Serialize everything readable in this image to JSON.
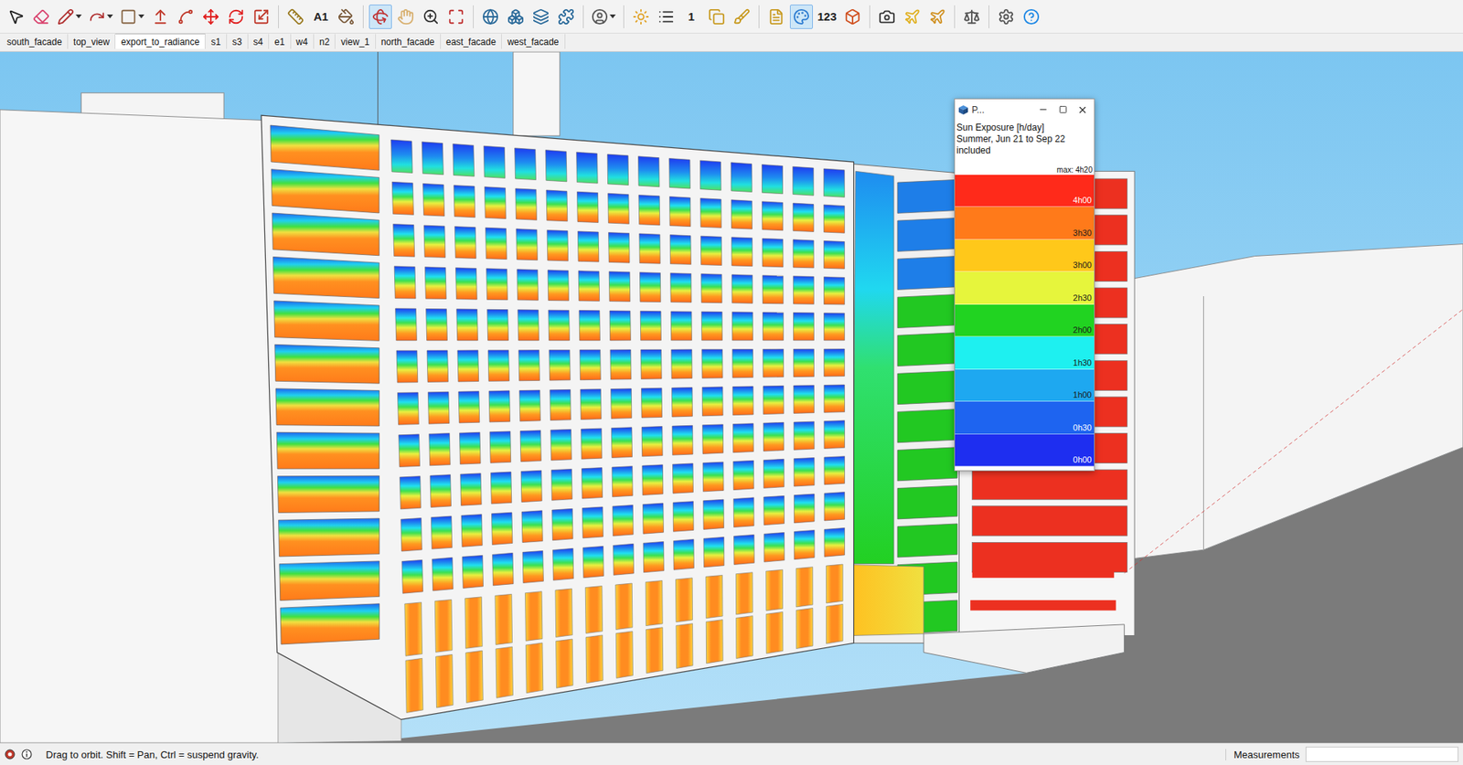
{
  "toolbar": {
    "items": [
      {
        "text": "",
        "selected": false
      },
      {
        "text": "",
        "selected": false
      },
      {
        "text": "",
        "selected": false
      },
      {
        "text": "",
        "selected": false
      },
      {
        "text": "",
        "selected": false
      },
      {
        "text": "",
        "selected": false
      },
      {
        "text": "",
        "selected": false
      },
      {
        "text": "",
        "selected": false
      },
      {
        "text": "",
        "selected": false
      },
      {
        "text": "",
        "selected": false
      },
      {
        "text": "",
        "selected": false
      },
      {
        "text": "A1",
        "selected": false
      },
      {
        "text": "",
        "selected": false
      },
      {
        "text": "",
        "selected": true
      },
      {
        "text": "",
        "selected": false
      },
      {
        "text": "",
        "selected": false
      },
      {
        "text": "",
        "selected": false
      },
      {
        "text": "",
        "selected": false
      },
      {
        "text": "",
        "selected": false
      },
      {
        "text": "",
        "selected": false
      },
      {
        "text": "",
        "selected": false
      },
      {
        "text": "",
        "selected": false
      },
      {
        "text": "",
        "selected": false
      },
      {
        "text": "",
        "selected": false
      },
      {
        "text": "1",
        "selected": false
      },
      {
        "text": "",
        "selected": false
      },
      {
        "text": "",
        "selected": false
      },
      {
        "text": "",
        "selected": false
      },
      {
        "text": "",
        "selected": true
      },
      {
        "text": "123",
        "selected": false
      },
      {
        "text": "",
        "selected": false
      },
      {
        "text": "",
        "selected": false
      },
      {
        "text": "",
        "selected": false
      },
      {
        "text": "",
        "selected": false
      },
      {
        "text": "",
        "selected": false
      },
      {
        "text": "",
        "selected": false
      },
      {
        "text": "",
        "selected": false
      }
    ]
  },
  "tabs": [
    {
      "label": "south_facade",
      "selected": false
    },
    {
      "label": "top_view",
      "selected": false
    },
    {
      "label": "export_to_radiance",
      "selected": true
    },
    {
      "label": "s1",
      "selected": false
    },
    {
      "label": "s3",
      "selected": false
    },
    {
      "label": "s4",
      "selected": false
    },
    {
      "label": "e1",
      "selected": false
    },
    {
      "label": "w4",
      "selected": false
    },
    {
      "label": "n2",
      "selected": false
    },
    {
      "label": "view_1",
      "selected": false
    },
    {
      "label": "north_facade",
      "selected": false
    },
    {
      "label": "east_facade",
      "selected": false
    },
    {
      "label": "west_facade",
      "selected": false
    }
  ],
  "legend": {
    "title": "P...",
    "lines": [
      "Sun Exposure [h/day]",
      "Summer, Jun 21 to Sep 22",
      "included"
    ],
    "max": "max: 4h20",
    "bands": [
      {
        "label": "4h00",
        "color": "#ff2a1a"
      },
      {
        "label": "3h30",
        "color": "#ff7a1a"
      },
      {
        "label": "3h00",
        "color": "#ffc81a"
      },
      {
        "label": "2h30",
        "color": "#e6f53c"
      },
      {
        "label": "2h00",
        "color": "#21d321"
      },
      {
        "label": "1h30",
        "color": "#1ef0f0"
      },
      {
        "label": "1h00",
        "color": "#1ea8f0"
      },
      {
        "label": "0h30",
        "color": "#1e64f0"
      },
      {
        "label": "0h00",
        "color": "#1e2ef0"
      }
    ]
  },
  "status_bar": {
    "hint": "Drag to orbit. Shift = Pan, Ctrl = suspend gravity.",
    "measurements_label": "Measurements",
    "measurements_value": ""
  }
}
